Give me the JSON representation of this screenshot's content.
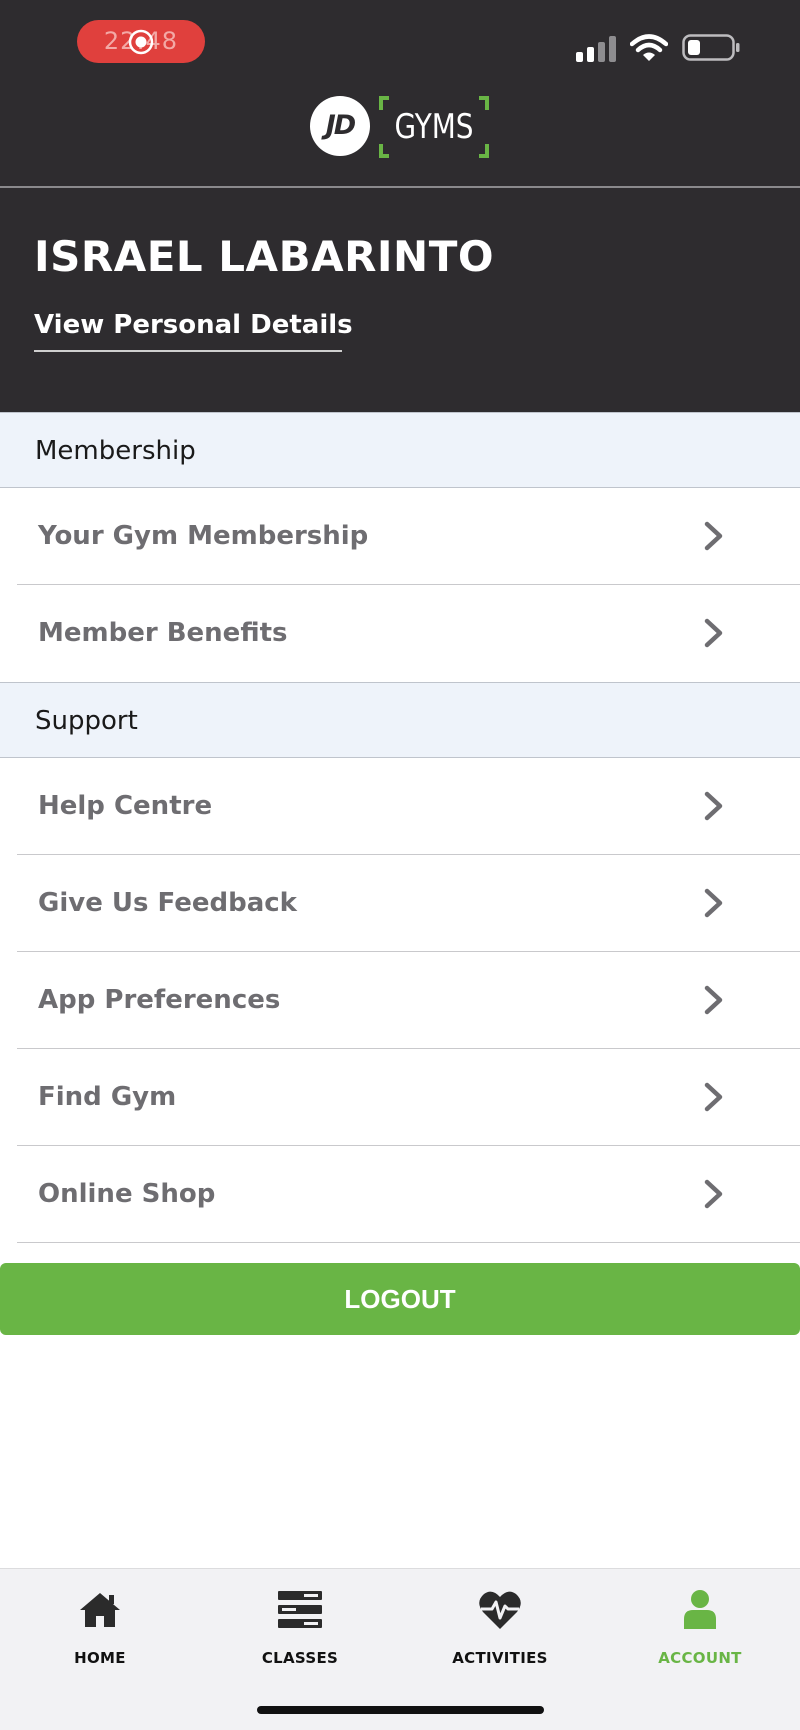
{
  "status_bar": {
    "time": "22:48",
    "recording_icon": "screen-record-icon",
    "signal_icon": "cellular-signal-icon",
    "wifi_icon": "wifi-icon",
    "battery_icon": "battery-low-icon"
  },
  "brand": {
    "logo_mark": "JD",
    "logo_text": "GYMS",
    "accent_color": "#69b545",
    "header_color": "#2e2c2f"
  },
  "profile": {
    "name": "ISRAEL LABARINTO",
    "details_link": "View Personal Details"
  },
  "sections": [
    {
      "title": "Membership",
      "items": [
        {
          "label": "Your Gym Membership"
        },
        {
          "label": "Member Benefits"
        }
      ]
    },
    {
      "title": "Support",
      "items": [
        {
          "label": "Help Centre"
        },
        {
          "label": "Give Us Feedback"
        },
        {
          "label": "App Preferences"
        },
        {
          "label": "Find Gym"
        },
        {
          "label": "Online Shop"
        }
      ]
    }
  ],
  "logout_label": "LOGOUT",
  "tabs": [
    {
      "label": "HOME",
      "icon": "home-icon",
      "active": false
    },
    {
      "label": "CLASSES",
      "icon": "classes-icon",
      "active": false
    },
    {
      "label": "ACTIVITIES",
      "icon": "heart-pulse-icon",
      "active": false
    },
    {
      "label": "ACCOUNT",
      "icon": "user-icon",
      "active": true
    }
  ]
}
